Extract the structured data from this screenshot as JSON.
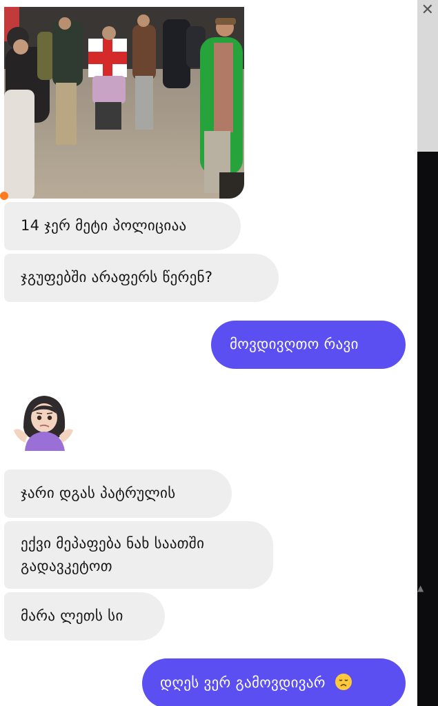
{
  "messages": [
    {
      "id": "m1",
      "direction": "incoming",
      "text": "14 ჯერ მეტი პოლიციაა"
    },
    {
      "id": "m2",
      "direction": "incoming",
      "text": "ჯგუფებში არაფერს წერენ?"
    },
    {
      "id": "m3",
      "direction": "outgoing",
      "text": "მოვდივღთო რავი"
    },
    {
      "id": "m4",
      "direction": "incoming",
      "type": "sticker",
      "emoji_name": "person-shrugging-icon"
    },
    {
      "id": "m5",
      "direction": "incoming",
      "text": "ჯარი დგას პატრულის"
    },
    {
      "id": "m6",
      "direction": "incoming",
      "lines": [
        "ექვი მეპაფება ნახ საათში",
        "გადავკეტოთ"
      ]
    },
    {
      "id": "m7",
      "direction": "incoming",
      "text": "მარა ლეთს სი"
    },
    {
      "id": "m8",
      "direction": "outgoing",
      "text": "დღეს ვერ გამოვდივარ",
      "emoji_name": "disappointed-face-icon"
    }
  ],
  "colors": {
    "outgoing": "#5b4ff1",
    "incoming": "#eeeeee",
    "unread_dot": "#ff7a1f"
  }
}
